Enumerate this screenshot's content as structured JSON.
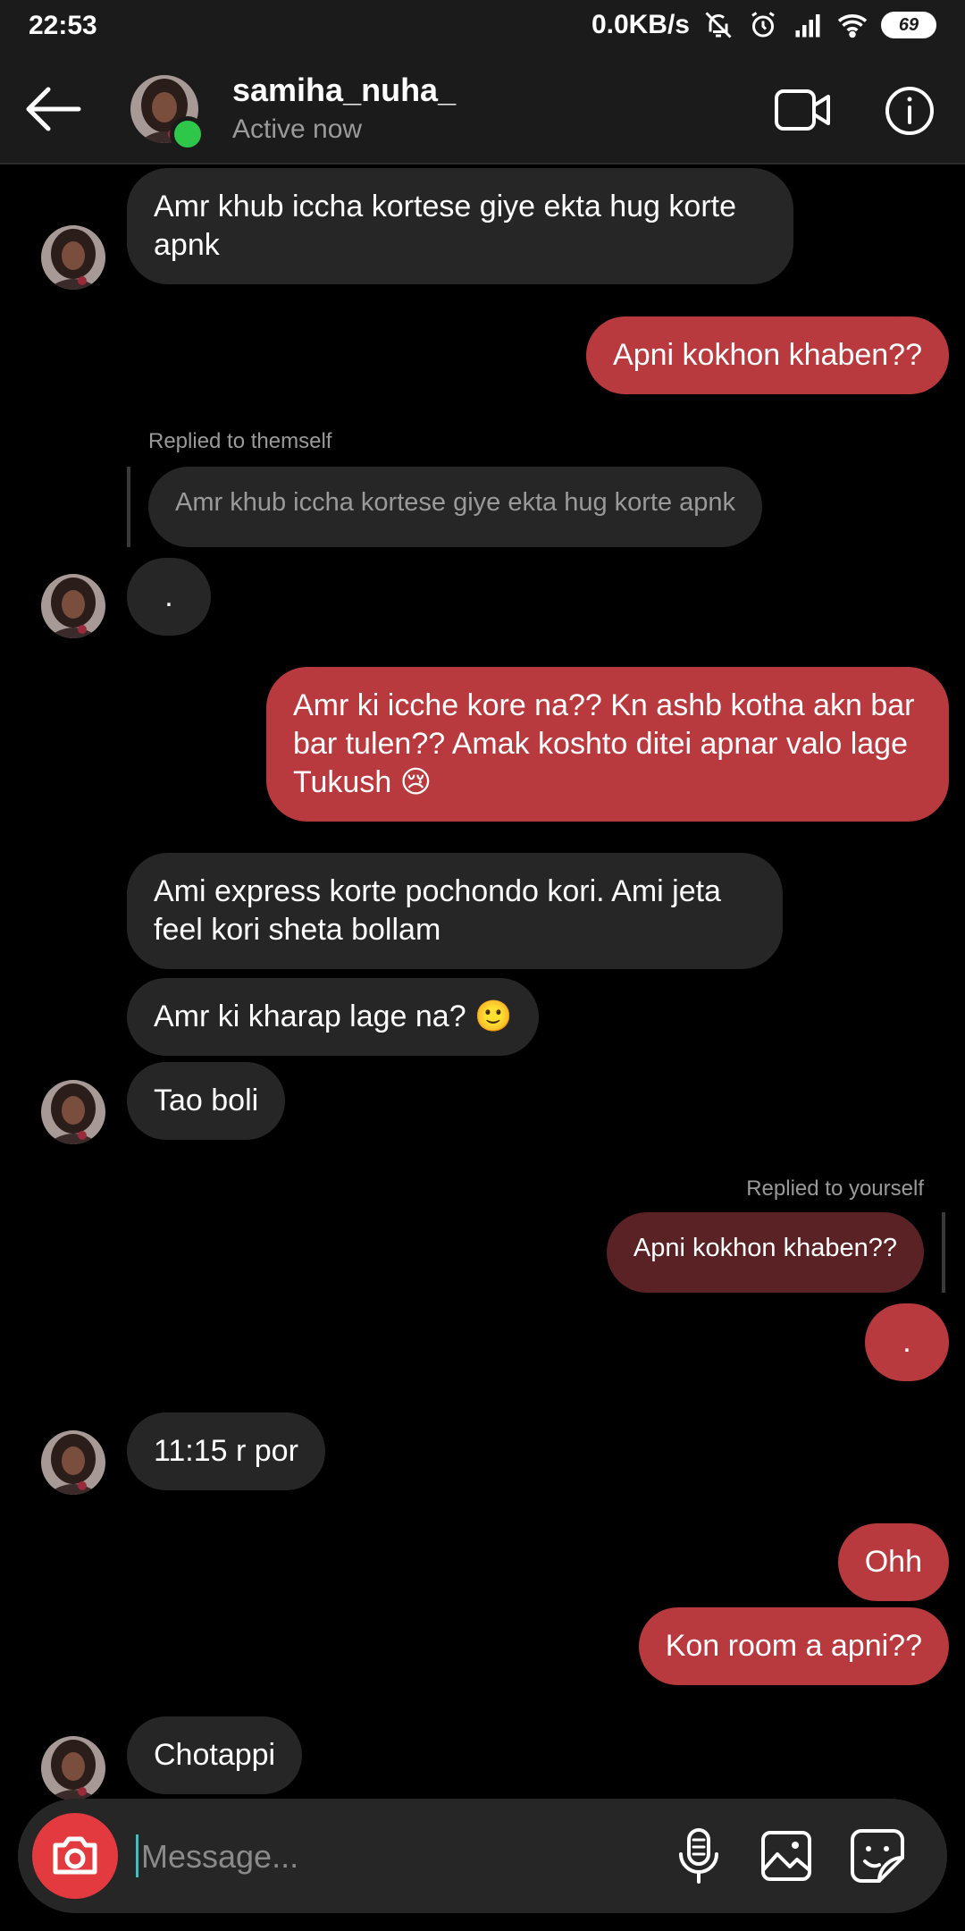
{
  "status_bar": {
    "time": "22:53",
    "network_speed": "0.0KB/s",
    "battery": "69",
    "icons": [
      "bell-muted-icon",
      "alarm-icon",
      "signal-icon",
      "wifi-icon",
      "battery-icon"
    ]
  },
  "header": {
    "username": "samiha_nuha_",
    "status": "Active now",
    "icons": [
      "back-arrow-icon",
      "video-call-icon",
      "info-icon"
    ],
    "online_color": "#2ec74a"
  },
  "messages": [
    {
      "side": "in",
      "text": "Amr khub iccha kortese giye ekta hug korte apnk"
    },
    {
      "side": "out",
      "text": "Apni kokhon khaben??"
    },
    {
      "side": "in",
      "reply_label": "Replied to themself",
      "quoted": "Amr khub iccha kortese giye ekta hug korte apnk",
      "text": "."
    },
    {
      "side": "out",
      "text": "Amr ki icche kore na?? Kn ashb kotha akn bar bar tulen?? Amak koshto ditei apnar valo lage Tukush 😢"
    },
    {
      "side": "in",
      "text": "Ami express korte pochondo kori. Ami jeta feel kori sheta bollam"
    },
    {
      "side": "in",
      "text": "Amr ki kharap lage na? 🙂"
    },
    {
      "side": "in",
      "text": "Tao boli"
    },
    {
      "side": "out",
      "reply_label": "Replied to yourself",
      "quoted": "Apni kokhon khaben??",
      "text": "."
    },
    {
      "side": "in",
      "text": "11:15 r por"
    },
    {
      "side": "out",
      "text": "Ohh"
    },
    {
      "side": "out",
      "text": "Kon room a apni??"
    },
    {
      "side": "in",
      "text": "Chotappi"
    }
  ],
  "composer": {
    "placeholder": "Message...",
    "icons": [
      "camera-icon",
      "microphone-icon",
      "gallery-icon",
      "sticker-icon"
    ]
  },
  "colors": {
    "background": "#000000",
    "incoming_bubble": "#262626",
    "outgoing_bubble": "#b93a3e",
    "camera_button": "#e23a3f"
  }
}
